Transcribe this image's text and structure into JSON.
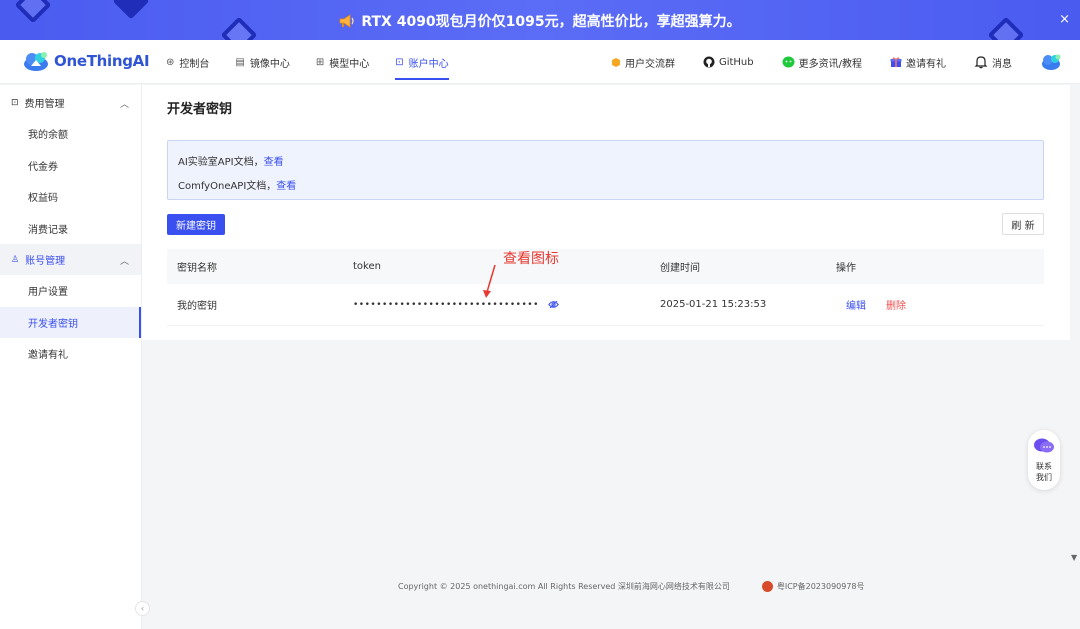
{
  "banner": {
    "text": "RTX 4090现包月价仅1095元，超高性价比，享超强算力。",
    "close": "×"
  },
  "header": {
    "logo_text": "OneThingAI",
    "nav": [
      {
        "label": "控制台",
        "icon": "dashboard-icon"
      },
      {
        "label": "镜像中心",
        "icon": "image-icon"
      },
      {
        "label": "模型中心",
        "icon": "model-icon"
      },
      {
        "label": "账户中心",
        "icon": "account-icon",
        "active": true
      }
    ],
    "right": [
      {
        "label": "用户交流群",
        "icon": "group-icon"
      },
      {
        "label": "GitHub",
        "icon": "github-icon"
      },
      {
        "label": "更多资讯/教程",
        "icon": "wechat-icon"
      },
      {
        "label": "邀请有礼",
        "icon": "gift-icon"
      },
      {
        "label": "消息",
        "icon": "bell-icon"
      }
    ]
  },
  "sidebar": {
    "group1": {
      "label": "费用管理",
      "items": [
        "我的余额",
        "代金券",
        "权益码",
        "消费记录"
      ]
    },
    "group2": {
      "label": "账号管理",
      "items": [
        "用户设置",
        "开发者密钥",
        "邀请有礼"
      ]
    }
  },
  "main": {
    "title": "开发者密钥",
    "docs": [
      {
        "text": "AI实验室API文档，",
        "link": "查看"
      },
      {
        "text": "ComfyOneAPI文档，",
        "link": "查看"
      }
    ],
    "new_button": "新建密钥",
    "refresh_button": "刷 新",
    "table": {
      "headers": [
        "密钥名称",
        "token",
        "创建时间",
        "操作"
      ],
      "rows": [
        {
          "name": "我的密钥",
          "token": "••••••••••••••••••••••••••••••••",
          "created": "2025-01-21 15:23:53",
          "edit": "编辑",
          "delete": "删除"
        }
      ]
    }
  },
  "annotation": {
    "text": "查看图标"
  },
  "contact": {
    "line1": "联系",
    "line2": "我们"
  },
  "footer": {
    "copyright": "Copyright © 2025 onethingai.com All Rights Reserved 深圳前海网心网络技术有限公司",
    "icp": "粤ICP备2023090978号"
  },
  "colors": {
    "accent": "#3a4ff0",
    "danger": "#f05050",
    "banner": "#5b6cf6",
    "annotation": "#e8382f"
  }
}
